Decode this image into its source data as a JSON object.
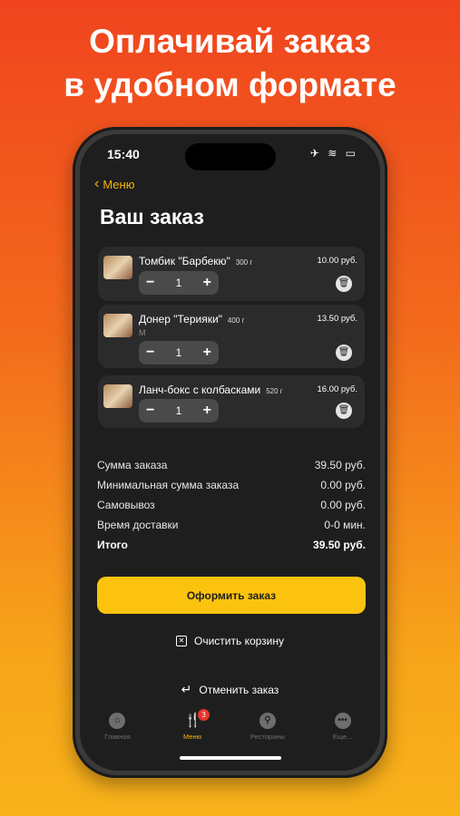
{
  "promo": {
    "line1": "Оплачивай заказ",
    "line2": "в удобном формате"
  },
  "status": {
    "time": "15:40",
    "icons": "✈ ≋ ▭"
  },
  "nav": {
    "back_label": "Меню"
  },
  "page": {
    "title": "Ваш заказ"
  },
  "items": [
    {
      "name": "Томбик \"Барбекю\"",
      "weight": "300 г",
      "modifier": "",
      "price": "10.00 руб.",
      "qty": "1"
    },
    {
      "name": "Донер \"Терияки\"",
      "weight": "400 г",
      "modifier": "М",
      "price": "13.50 руб.",
      "qty": "1"
    },
    {
      "name": "Ланч-бокс с колбасками",
      "weight": "520 г",
      "modifier": "",
      "price": "16.00 руб.",
      "qty": "1"
    }
  ],
  "summary": [
    {
      "label": "Сумма заказа",
      "value": "39.50 руб."
    },
    {
      "label": "Минимальная сумма заказа",
      "value": "0.00 руб."
    },
    {
      "label": "Самовывоз",
      "value": "0.00 руб."
    },
    {
      "label": "Время доставки",
      "value": "0-0 мин."
    },
    {
      "label": "Итого",
      "value": "39.50 руб."
    }
  ],
  "actions": {
    "order": "Оформить заказ",
    "clear": "Очистить корзину",
    "cancel": "Отменить заказ"
  },
  "tabbar": {
    "tabs": [
      {
        "label": "Главная",
        "icon": "home-icon"
      },
      {
        "label": "Меню",
        "icon": "fork-knife-icon",
        "badge": "3"
      },
      {
        "label": "Рестораны",
        "icon": "location-pin-icon"
      },
      {
        "label": "Еще...",
        "icon": "more-icon"
      }
    ]
  },
  "colors": {
    "accent": "#fcc30e",
    "badge": "#e8352b",
    "background": "#1e1e1e"
  }
}
